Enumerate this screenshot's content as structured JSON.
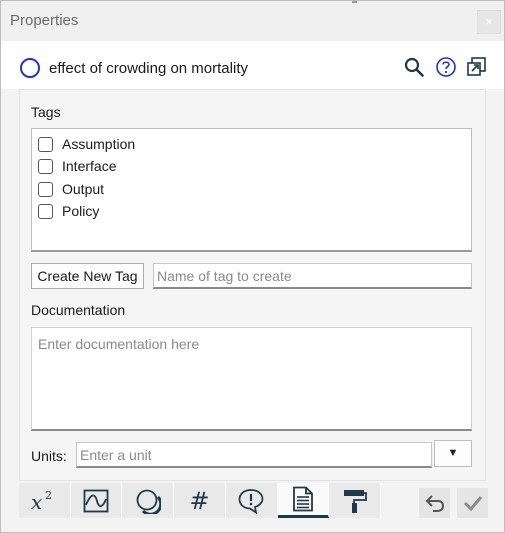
{
  "window": {
    "title": "Properties",
    "close_glyph": "×"
  },
  "header": {
    "variable_name": "effect of crowding on mortality",
    "type_icon": "circle-icon",
    "icons": [
      "search-icon",
      "help-icon",
      "popout-icon"
    ]
  },
  "tags": {
    "label": "Tags",
    "items": [
      {
        "label": "Assumption",
        "checked": false
      },
      {
        "label": "Interface",
        "checked": false
      },
      {
        "label": "Output",
        "checked": false
      },
      {
        "label": "Policy",
        "checked": false
      }
    ],
    "create_button": "Create New Tag",
    "new_tag_placeholder": "Name of tag to create"
  },
  "documentation": {
    "label": "Documentation",
    "placeholder": "Enter documentation here"
  },
  "units": {
    "label": "Units:",
    "placeholder": "Enter a unit",
    "dropdown_glyph": "▼"
  },
  "tabs": [
    {
      "name": "equation-tab",
      "icon": "x-squared-icon",
      "active": false
    },
    {
      "name": "graph-tab",
      "icon": "graph-curve-icon",
      "active": false
    },
    {
      "name": "appearance-tab",
      "icon": "circles-icon",
      "active": false
    },
    {
      "name": "number-format-tab",
      "icon": "hash-icon",
      "active": false
    },
    {
      "name": "warnings-tab",
      "icon": "alert-bubble-icon",
      "active": false
    },
    {
      "name": "documentation-tab",
      "icon": "document-icon",
      "active": true
    },
    {
      "name": "style-tab",
      "icon": "paint-roller-icon",
      "active": false
    }
  ],
  "tab_labels": {
    "hash": "#"
  },
  "colors": {
    "accent": "#1e3a4a",
    "circle": "#2233cc",
    "help": "#2233cc"
  }
}
